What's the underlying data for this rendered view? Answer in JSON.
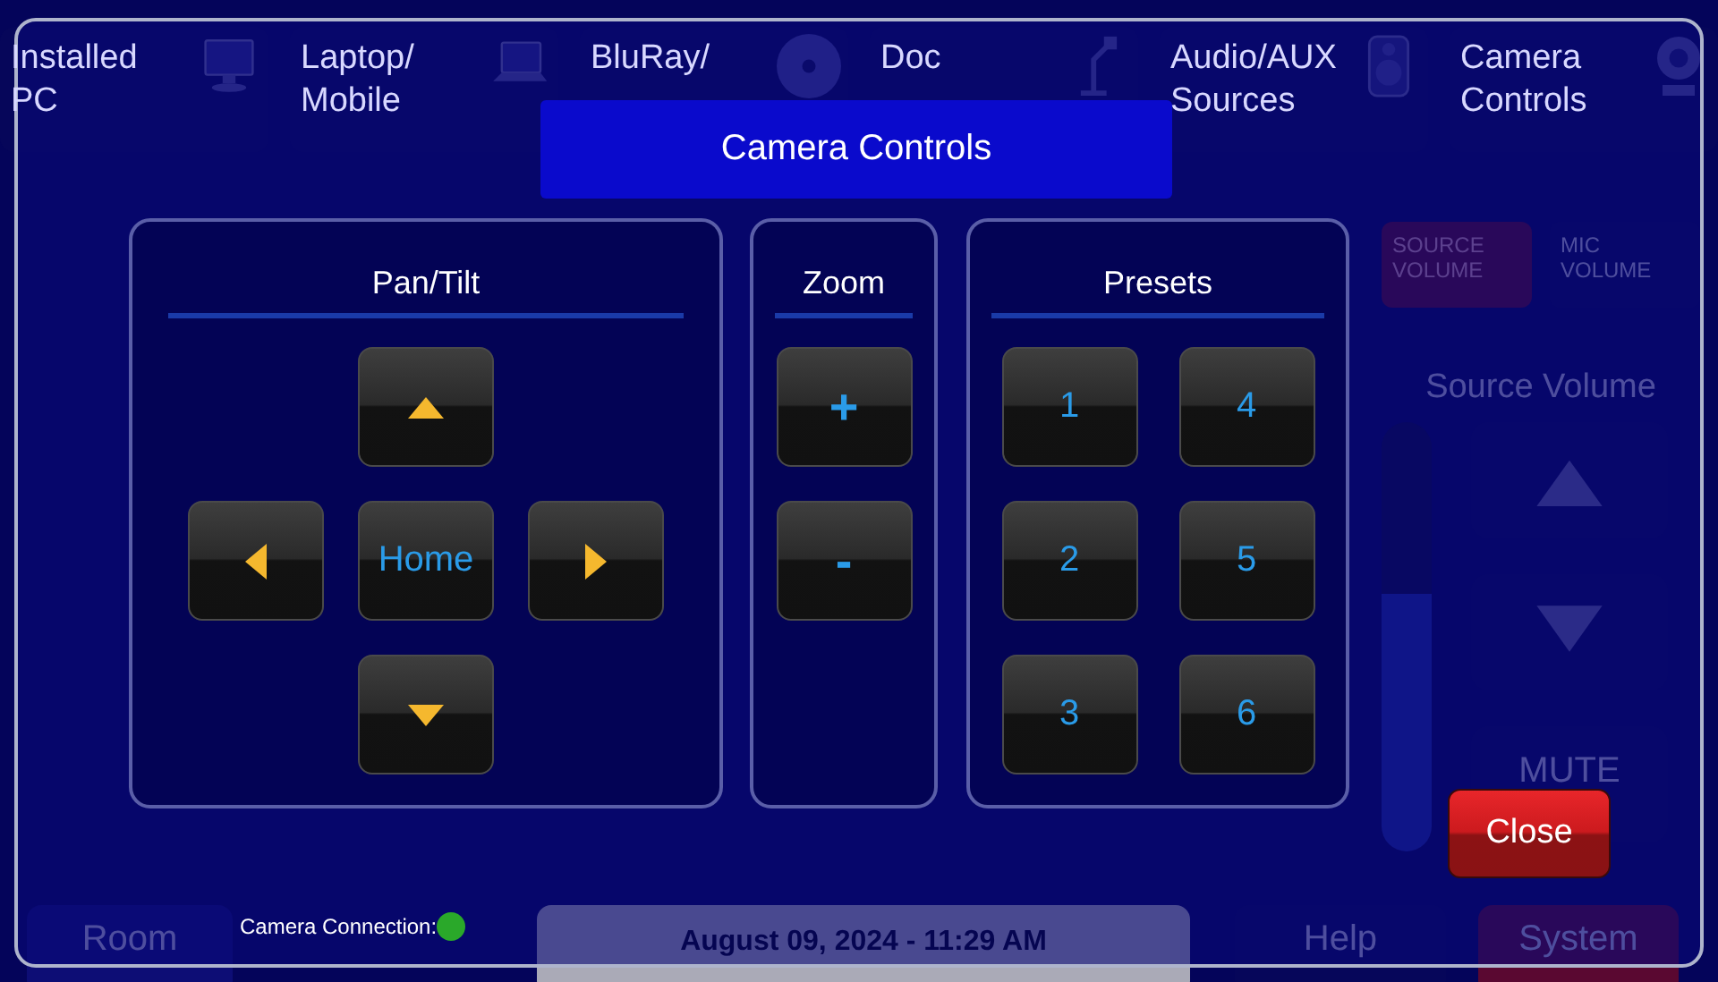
{
  "background_screen": {
    "source_buttons": [
      {
        "label": "Installed PC",
        "kind": "monitor"
      },
      {
        "label": "Laptop/ Mobile",
        "kind": "laptop"
      },
      {
        "label": "BluRay/",
        "kind": "disc"
      },
      {
        "label": "Doc",
        "kind": "doccam"
      },
      {
        "label": "Audio/AUX Sources",
        "kind": "speaker"
      },
      {
        "label": "Camera Controls",
        "kind": "camera"
      }
    ],
    "volume_tabs": [
      {
        "label": "SOURCE VOLUME",
        "selected": true
      },
      {
        "label": "MIC VOLUME",
        "selected": false
      }
    ],
    "volume_title": "Source Volume",
    "volume_slider": {
      "level": 0.6
    },
    "mute_button": "MUTE",
    "bottom_bar": {
      "room_button": "Room",
      "date_time": "August 09, 2024  -  11:29 AM",
      "help_button": "Help",
      "system_button": "System"
    }
  },
  "dialog": {
    "title": "Camera Controls",
    "pan_tilt": {
      "title": "Pan/Tilt",
      "home_label": "Home"
    },
    "zoom": {
      "title": "Zoom",
      "buttons": [
        "+",
        "-"
      ]
    },
    "presets": {
      "title": "Presets",
      "buttons": [
        "1",
        "2",
        "3",
        "4",
        "5",
        "6"
      ]
    },
    "close_button": "Close",
    "status": {
      "label": "Camera Connection:",
      "connected": true
    }
  }
}
